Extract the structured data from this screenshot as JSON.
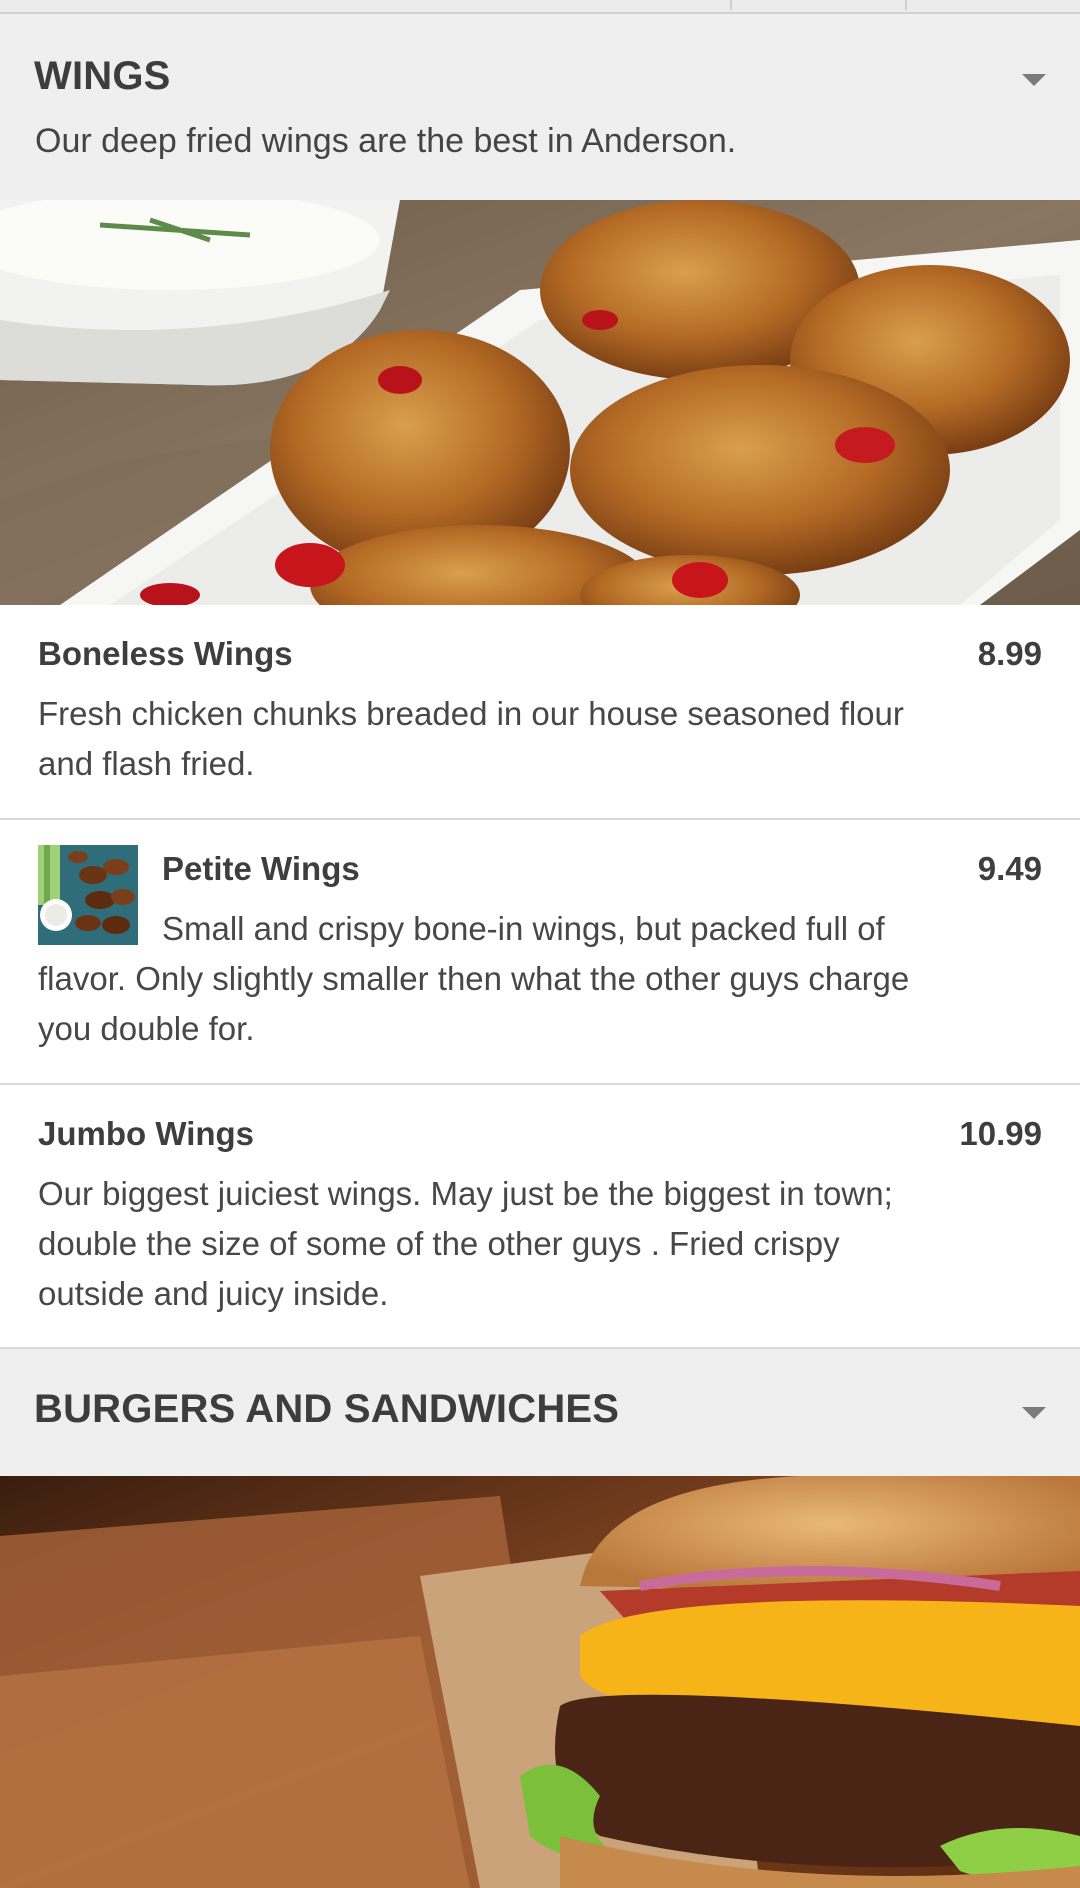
{
  "colors": {
    "header_bg": "#efefef",
    "text": "#3e3e3e",
    "divider": "#d9d9d9"
  },
  "sections": [
    {
      "title": "WINGS",
      "description": "Our deep fried wings are the best in Anderson.",
      "icon": "chevron-down-icon"
    },
    {
      "title": "BURGERS AND SANDWICHES",
      "description": "",
      "icon": "chevron-down-icon"
    }
  ],
  "items": [
    {
      "name": "Boneless Wings",
      "price": "8.99",
      "description": "Fresh chicken chunks breaded in our house seasoned flour and flash fried."
    },
    {
      "name": "Petite Wings",
      "price": "9.49",
      "description": "Small and crispy bone-in wings, but packed full of flavor. Only slightly smaller then what the other guys charge you double for."
    },
    {
      "name": "Jumbo Wings",
      "price": "10.99",
      "description": "Our biggest juiciest wings. May just be the biggest in town; double the size of some of the other guys . Fried crispy outside and juicy inside."
    }
  ]
}
